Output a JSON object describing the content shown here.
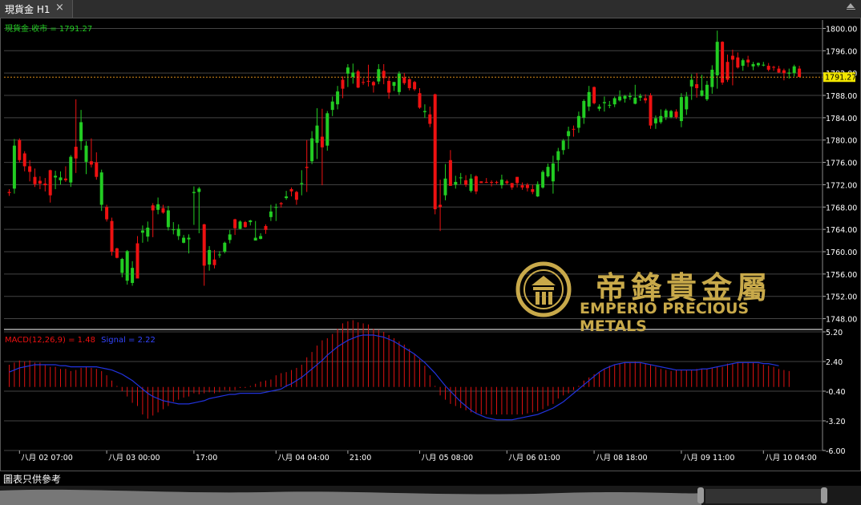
{
  "window": {
    "tab_title": "現貨金 H1",
    "close": "×"
  },
  "price_panel": {
    "label": "現貨金.收市 = 1791.27",
    "current_price": 1791.27,
    "current_price_label": "1791.27",
    "y_ticks": [
      "1800.00",
      "1796.00",
      "1792.00",
      "1788.00",
      "1784.00",
      "1780.00",
      "1776.00",
      "1772.00",
      "1768.00",
      "1764.00",
      "1760.00",
      "1756.00",
      "1752.00",
      "1748.00"
    ]
  },
  "macd_panel": {
    "label_macd": "MACD(12,26,9) = 1.48",
    "label_signal": "Signal = 2.22",
    "y_ticks": [
      "5.20",
      "2.40",
      "-0.40",
      "-3.20",
      "-6.00"
    ]
  },
  "x_labels": [
    "八月 02 07:00",
    "八月 03 00:00",
    "17:00",
    "八月 04 04:00",
    "21:00",
    "八月 05 08:00",
    "八月 06 01:00",
    "八月 08 18:00",
    "八月 09 11:00",
    "八月 10 04:00"
  ],
  "footer": "圖表只供參考",
  "logo": {
    "cn": "帝鋒貴金屬",
    "en": "EMPERIO PRECIOUS METALS"
  },
  "colors": {
    "up": "#22cc22",
    "down": "#ee1111",
    "signal": "#2233dd",
    "macd": "#dd1111",
    "logo": "#c8a94a"
  },
  "chart_data": {
    "type": "candlestick",
    "title": "現貨金 H1",
    "ylim": [
      1746.5,
      1801.5
    ],
    "candles": [
      [
        1770.7,
        1771.2,
        1770.0,
        1770.5
      ],
      [
        1771.3,
        1780.2,
        1770.4,
        1779.0
      ],
      [
        1780.0,
        1780.3,
        1776.0,
        1776.4
      ],
      [
        1777.6,
        1778.0,
        1774.4,
        1775.3
      ],
      [
        1775.3,
        1776.4,
        1772.6,
        1774.3
      ],
      [
        1773.4,
        1774.9,
        1771.6,
        1772.1
      ],
      [
        1772.7,
        1773.5,
        1771.2,
        1772.2
      ],
      [
        1772.2,
        1773.2,
        1770.8,
        1771.9
      ],
      [
        1774.6,
        1774.7,
        1768.8,
        1770.1
      ],
      [
        1773.3,
        1774.5,
        1771.2,
        1773.6
      ],
      [
        1772.8,
        1774.4,
        1772.0,
        1773.3
      ],
      [
        1773.1,
        1775.3,
        1772.5,
        1772.8
      ],
      [
        1772.4,
        1777.3,
        1771.6,
        1777.0
      ],
      [
        1778.8,
        1787.3,
        1774.1,
        1776.7
      ],
      [
        1779.8,
        1785.4,
        1778.2,
        1783.2
      ],
      [
        1776.1,
        1779.8,
        1773.9,
        1779.0
      ],
      [
        1776.2,
        1780.3,
        1775.1,
        1775.6
      ],
      [
        1776.0,
        1777.8,
        1772.9,
        1773.4
      ],
      [
        1768.4,
        1774.7,
        1767.3,
        1774.2
      ],
      [
        1768.0,
        1768.4,
        1765.4,
        1765.8
      ],
      [
        1765.5,
        1766.1,
        1759.3,
        1760.0
      ],
      [
        1760.6,
        1760.7,
        1758.8,
        1758.9
      ],
      [
        1756.2,
        1758.9,
        1755.4,
        1758.7
      ],
      [
        1754.8,
        1760.3,
        1754.1,
        1760.1
      ],
      [
        1754.4,
        1758.3,
        1753.9,
        1757.1
      ],
      [
        1761.5,
        1762.8,
        1755.4,
        1755.2
      ],
      [
        1763.4,
        1764.7,
        1761.6,
        1763.8
      ],
      [
        1762.7,
        1765.4,
        1761.8,
        1764.3
      ],
      [
        1768.3,
        1768.7,
        1762.6,
        1767.4
      ],
      [
        1767.5,
        1769.7,
        1766.7,
        1768.5
      ],
      [
        1767.8,
        1768.4,
        1766.8,
        1767.0
      ],
      [
        1764.4,
        1768.2,
        1763.8,
        1767.4
      ],
      [
        1764.0,
        1765.3,
        1763.1,
        1764.0
      ],
      [
        1762.8,
        1764.9,
        1762.1,
        1764.1
      ],
      [
        1761.6,
        1763.0,
        1761.5,
        1762.5
      ],
      [
        1762.2,
        1763.1,
        1759.7,
        1762.5
      ],
      [
        1770.5,
        1771.7,
        1764.8,
        1770.7
      ],
      [
        1770.7,
        1771.6,
        1763.3,
        1771.3
      ],
      [
        1764.9,
        1765.0,
        1753.9,
        1757.5
      ],
      [
        1757.7,
        1761.0,
        1756.6,
        1760.3
      ],
      [
        1758.6,
        1760.3,
        1757.0,
        1757.6
      ],
      [
        1759.5,
        1760.1,
        1758.9,
        1759.5
      ],
      [
        1760.0,
        1761.8,
        1759.7,
        1761.6
      ],
      [
        1762.1,
        1763.9,
        1761.5,
        1763.1
      ],
      [
        1765.8,
        1765.9,
        1763.0,
        1764.2
      ],
      [
        1764.1,
        1765.6,
        1764.0,
        1765.4
      ],
      [
        1765.3,
        1765.5,
        1764.3,
        1764.4
      ],
      [
        1765.3,
        1765.7,
        1764.7,
        1765.6
      ],
      [
        1762.0,
        1765.5,
        1762.0,
        1762.5
      ],
      [
        1762.3,
        1763.3,
        1762.2,
        1762.8
      ],
      [
        1764.6,
        1764.9,
        1763.2,
        1763.9
      ],
      [
        1766.2,
        1768.4,
        1765.5,
        1767.2
      ],
      [
        1767.9,
        1768.6,
        1765.5,
        1768.0
      ],
      [
        1768.7,
        1768.9,
        1767.9,
        1768.5
      ],
      [
        1769.6,
        1770.9,
        1769.3,
        1769.9
      ],
      [
        1771.2,
        1771.5,
        1769.9,
        1770.8
      ],
      [
        1770.7,
        1770.9,
        1768.4,
        1769.3
      ],
      [
        1772.1,
        1774.6,
        1770.1,
        1772.3
      ],
      [
        1775.2,
        1780.0,
        1770.7,
        1775.0
      ],
      [
        1776.2,
        1781.6,
        1775.7,
        1780.3
      ],
      [
        1779.5,
        1785.7,
        1776.6,
        1782.6
      ],
      [
        1780.6,
        1785.6,
        1771.9,
        1778.7
      ],
      [
        1779.0,
        1785.2,
        1778.1,
        1784.8
      ],
      [
        1785.4,
        1787.8,
        1784.3,
        1786.9
      ],
      [
        1786.4,
        1789.7,
        1785.5,
        1788.7
      ],
      [
        1790.8,
        1791.4,
        1787.5,
        1789.2
      ],
      [
        1791.9,
        1793.6,
        1789.5,
        1793.0
      ],
      [
        1791.3,
        1793.7,
        1790.1,
        1792.1
      ],
      [
        1792.3,
        1792.6,
        1789.3,
        1789.4
      ],
      [
        1790.4,
        1791.1,
        1789.9,
        1790.3
      ],
      [
        1790.6,
        1793.5,
        1789.6,
        1790.5
      ],
      [
        1790.4,
        1790.6,
        1788.5,
        1789.8
      ],
      [
        1790.5,
        1793.6,
        1790.0,
        1792.7
      ],
      [
        1792.4,
        1793.6,
        1790.0,
        1791.1
      ],
      [
        1790.6,
        1791.4,
        1787.4,
        1788.5
      ],
      [
        1789.7,
        1790.4,
        1788.8,
        1790.4
      ],
      [
        1788.6,
        1792.3,
        1788.1,
        1791.9
      ],
      [
        1791.2,
        1792.0,
        1789.9,
        1790.2
      ],
      [
        1790.9,
        1791.1,
        1788.9,
        1789.3
      ],
      [
        1790.4,
        1790.6,
        1788.8,
        1789.1
      ],
      [
        1788.4,
        1789.3,
        1785.6,
        1785.8
      ],
      [
        1785.0,
        1786.4,
        1784.0,
        1785.2
      ],
      [
        1784.6,
        1786.0,
        1782.3,
        1782.9
      ],
      [
        1788.2,
        1788.3,
        1766.7,
        1767.6
      ],
      [
        1768.4,
        1772.9,
        1763.7,
        1768.0
      ],
      [
        1770.1,
        1775.7,
        1769.2,
        1773.1
      ],
      [
        1776.4,
        1778.2,
        1771.8,
        1771.8
      ],
      [
        1772.0,
        1773.6,
        1771.3,
        1772.5
      ],
      [
        1773.3,
        1774.1,
        1772.1,
        1773.3
      ],
      [
        1772.8,
        1773.7,
        1771.6,
        1772.0
      ],
      [
        1770.9,
        1773.9,
        1770.6,
        1773.1
      ],
      [
        1773.5,
        1773.7,
        1770.3,
        1770.8
      ],
      [
        1772.6,
        1772.6,
        1772.4,
        1772.3
      ],
      [
        1772.5,
        1773.2,
        1772.3,
        1772.4
      ],
      [
        1772.5,
        1772.8,
        1771.7,
        1772.4
      ],
      [
        1772.5,
        1772.7,
        1772.1,
        1772.4
      ],
      [
        1771.9,
        1773.8,
        1771.3,
        1772.9
      ],
      [
        1772.6,
        1772.9,
        1772.0,
        1772.3
      ],
      [
        1772.3,
        1772.3,
        1771.1,
        1771.5
      ],
      [
        1773.4,
        1773.4,
        1771.5,
        1772.3
      ],
      [
        1771.9,
        1772.4,
        1771.1,
        1771.5
      ],
      [
        1772.0,
        1772.3,
        1770.8,
        1771.4
      ],
      [
        1771.2,
        1772.0,
        1770.3,
        1770.7
      ],
      [
        1769.9,
        1772.6,
        1769.8,
        1772.1
      ],
      [
        1771.5,
        1774.6,
        1771.3,
        1774.3
      ],
      [
        1773.5,
        1775.8,
        1773.3,
        1775.2
      ],
      [
        1772.6,
        1777.2,
        1770.4,
        1775.8
      ],
      [
        1776.4,
        1778.6,
        1774.4,
        1778.0
      ],
      [
        1778.2,
        1780.2,
        1777.4,
        1779.9
      ],
      [
        1780.7,
        1782.4,
        1778.4,
        1781.6
      ],
      [
        1782.0,
        1782.6,
        1780.6,
        1781.9
      ],
      [
        1782.2,
        1785.1,
        1781.3,
        1784.3
      ],
      [
        1784.0,
        1787.3,
        1782.9,
        1787.0
      ],
      [
        1786.0,
        1789.7,
        1785.2,
        1788.6
      ],
      [
        1789.5,
        1789.6,
        1786.4,
        1786.6
      ],
      [
        1785.6,
        1786.4,
        1785.2,
        1786.0
      ],
      [
        1786.6,
        1787.8,
        1785.1,
        1786.8
      ],
      [
        1786.3,
        1787.0,
        1785.7,
        1786.3
      ],
      [
        1786.4,
        1787.8,
        1785.9,
        1787.5
      ],
      [
        1787.1,
        1788.9,
        1786.9,
        1787.8
      ],
      [
        1787.4,
        1788.1,
        1786.7,
        1787.9
      ],
      [
        1787.7,
        1788.5,
        1787.2,
        1787.9
      ],
      [
        1786.5,
        1789.9,
        1786.4,
        1787.6
      ],
      [
        1787.6,
        1788.3,
        1787.0,
        1787.9
      ],
      [
        1787.5,
        1788.2,
        1786.6,
        1787.1
      ],
      [
        1788.0,
        1788.4,
        1782.0,
        1782.6
      ],
      [
        1783.0,
        1784.4,
        1782.0,
        1783.9
      ],
      [
        1783.2,
        1785.5,
        1782.9,
        1784.3
      ],
      [
        1784.1,
        1785.6,
        1783.6,
        1785.3
      ],
      [
        1784.1,
        1785.4,
        1783.9,
        1785.2
      ],
      [
        1785.1,
        1785.5,
        1783.8,
        1784.1
      ],
      [
        1783.4,
        1788.4,
        1782.3,
        1787.7
      ],
      [
        1785.5,
        1788.6,
        1784.5,
        1787.8
      ],
      [
        1789.6,
        1791.8,
        1787.2,
        1790.8
      ],
      [
        1790.0,
        1792.0,
        1787.6,
        1789.3
      ],
      [
        1787.9,
        1791.7,
        1787.8,
        1788.9
      ],
      [
        1787.3,
        1790.6,
        1787.0,
        1789.9
      ],
      [
        1789.5,
        1793.4,
        1788.3,
        1792.6
      ],
      [
        1791.6,
        1799.6,
        1789.2,
        1797.6
      ],
      [
        1797.6,
        1797.7,
        1789.9,
        1790.3
      ],
      [
        1794.0,
        1795.3,
        1790.4,
        1790.8
      ],
      [
        1795.1,
        1796.2,
        1789.8,
        1794.4
      ],
      [
        1794.8,
        1795.7,
        1792.8,
        1793.0
      ],
      [
        1793.3,
        1794.6,
        1792.4,
        1794.3
      ],
      [
        1794.4,
        1795.1,
        1793.1,
        1793.9
      ],
      [
        1793.2,
        1794.0,
        1792.5,
        1793.6
      ],
      [
        1793.4,
        1793.9,
        1793.1,
        1793.8
      ],
      [
        1793.4,
        1794.0,
        1793.2,
        1793.5
      ],
      [
        1793.3,
        1793.8,
        1792.3,
        1792.6
      ],
      [
        1793.1,
        1793.3,
        1792.4,
        1793.0
      ],
      [
        1792.8,
        1793.3,
        1792.0,
        1792.1
      ],
      [
        1792.5,
        1792.8,
        1790.7,
        1792.0
      ],
      [
        1791.9,
        1792.8,
        1791.0,
        1792.1
      ],
      [
        1792.0,
        1793.5,
        1791.4,
        1793.2
      ],
      [
        1792.8,
        1793.3,
        1791.3,
        1791.3
      ]
    ],
    "macd_ylim": [
      -6.0,
      5.2
    ],
    "macd_hist": [
      2.1,
      2.3,
      2.5,
      2.4,
      2.5,
      2.3,
      2.3,
      2.1,
      1.9,
      1.9,
      1.7,
      1.7,
      1.5,
      1.6,
      1.8,
      1.9,
      1.8,
      1.7,
      1.5,
      1.1,
      0.6,
      0.1,
      -0.4,
      -0.9,
      -1.5,
      -1.8,
      -2.6,
      -3.0,
      -2.7,
      -2.4,
      -2.1,
      -1.8,
      -1.4,
      -1.2,
      -1.0,
      -0.9,
      -0.6,
      -0.7,
      -0.6,
      -0.5,
      -0.6,
      -0.5,
      -0.3,
      -0.4,
      -0.3,
      -0.1,
      -0.1,
      0.1,
      0.3,
      0.5,
      0.6,
      0.7,
      1.1,
      1.3,
      1.4,
      1.6,
      1.8,
      2.1,
      2.8,
      3.3,
      3.9,
      4.4,
      4.6,
      5.0,
      5.5,
      6.0,
      6.2,
      6.3,
      6.1,
      6.0,
      5.9,
      5.5,
      5.4,
      5.2,
      4.9,
      4.6,
      4.3,
      4.0,
      3.6,
      3.1,
      2.6,
      2.0,
      1.1,
      0.1,
      -0.8,
      -1.2,
      -1.6,
      -1.8,
      -2.0,
      -2.2,
      -2.4,
      -2.5,
      -2.6,
      -2.6,
      -2.6,
      -2.6,
      -2.6,
      -2.6,
      -2.6,
      -2.6,
      -2.6,
      -2.5,
      -2.4,
      -2.3,
      -2.1,
      -1.8,
      -1.6,
      -1.1,
      -0.8,
      -0.6,
      -0.3,
      0.1,
      0.6,
      0.9,
      1.2,
      1.4,
      1.7,
      2.0,
      2.1,
      2.2,
      2.3,
      2.3,
      2.4,
      2.3,
      2.2,
      2.1,
      1.9,
      1.7,
      1.6,
      1.5,
      1.6,
      1.6,
      1.6,
      1.6,
      1.7,
      1.7,
      1.7,
      1.8,
      1.9,
      1.9,
      2.2,
      2.2,
      2.3,
      2.3,
      2.3,
      2.3,
      2.2,
      2.1,
      2.0,
      1.9,
      1.7,
      1.6,
      1.5
    ],
    "signal": [
      1.4,
      1.6,
      1.8,
      1.9,
      2.0,
      2.1,
      2.1,
      2.1,
      2.1,
      2.1,
      2.0,
      2.0,
      1.9,
      1.9,
      1.9,
      1.9,
      1.9,
      1.9,
      1.8,
      1.7,
      1.6,
      1.4,
      1.2,
      0.9,
      0.6,
      0.2,
      -0.2,
      -0.6,
      -0.9,
      -1.1,
      -1.3,
      -1.4,
      -1.5,
      -1.6,
      -1.6,
      -1.6,
      -1.5,
      -1.4,
      -1.3,
      -1.1,
      -1.0,
      -0.9,
      -0.8,
      -0.7,
      -0.7,
      -0.6,
      -0.6,
      -0.6,
      -0.6,
      -0.6,
      -0.5,
      -0.4,
      -0.3,
      -0.2,
      0.1,
      0.3,
      0.6,
      0.9,
      1.3,
      1.7,
      2.1,
      2.5,
      3.0,
      3.4,
      3.8,
      4.1,
      4.4,
      4.6,
      4.8,
      4.9,
      4.9,
      4.9,
      4.8,
      4.7,
      4.5,
      4.3,
      4.0,
      3.7,
      3.4,
      3.1,
      2.7,
      2.3,
      1.8,
      1.3,
      0.7,
      0.1,
      -0.4,
      -0.9,
      -1.4,
      -1.8,
      -2.2,
      -2.5,
      -2.7,
      -2.9,
      -3.0,
      -3.1,
      -3.1,
      -3.1,
      -3.1,
      -3.0,
      -2.9,
      -2.8,
      -2.7,
      -2.6,
      -2.4,
      -2.2,
      -2.0,
      -1.7,
      -1.4,
      -1.0,
      -0.6,
      -0.2,
      0.2,
      0.6,
      1.0,
      1.4,
      1.7,
      1.9,
      2.1,
      2.2,
      2.3,
      2.3,
      2.3,
      2.3,
      2.2,
      2.1,
      2.0,
      1.9,
      1.8,
      1.7,
      1.6,
      1.6,
      1.6,
      1.6,
      1.6,
      1.7,
      1.7,
      1.8,
      1.9,
      2.0,
      2.1,
      2.2,
      2.3,
      2.3,
      2.3,
      2.3,
      2.3,
      2.2,
      2.2,
      2.1,
      2.0
    ]
  }
}
